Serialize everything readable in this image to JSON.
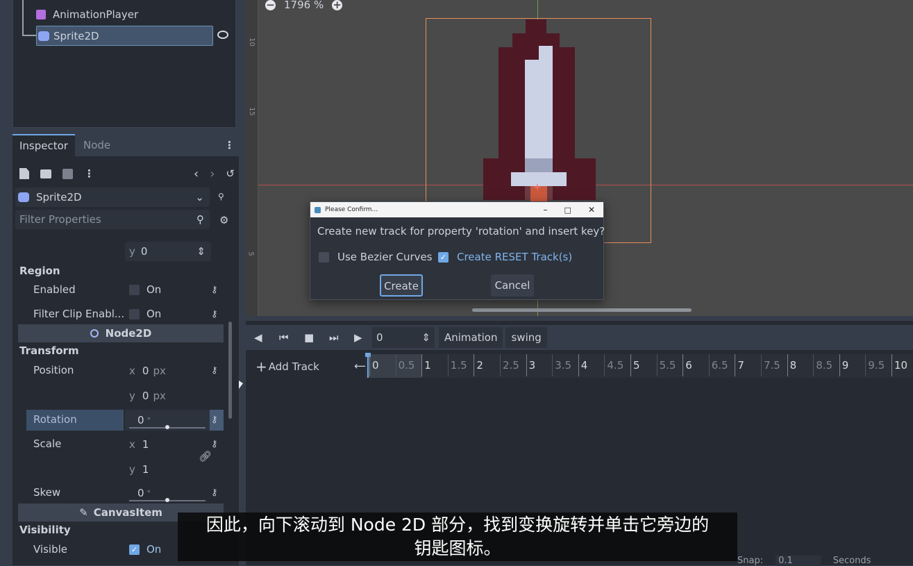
{
  "scene_tree": {
    "items": [
      {
        "label": "AnimationPlayer"
      },
      {
        "label": "Sprite2D"
      }
    ]
  },
  "inspector": {
    "tabs": [
      "Inspector",
      "Node"
    ],
    "object_name": "Sprite2D",
    "filter_placeholder": "Filter Properties",
    "offset_y": {
      "axis": "y",
      "value": "0"
    },
    "region": {
      "title": "Region",
      "enabled_label": "Enabled",
      "enabled_value": "On",
      "filter_clip_label": "Filter Clip Enabl...",
      "filter_clip_value": "On"
    },
    "node2d_header": "Node2D",
    "transform": {
      "title": "Transform",
      "position_label": "Position",
      "pos_x": "0",
      "pos_y": "0",
      "unit": "px",
      "rotation_label": "Rotation",
      "rotation_value": "0",
      "deg": "°",
      "scale_label": "Scale",
      "scale_x": "1",
      "scale_y": "1",
      "skew_label": "Skew",
      "skew_value": "0"
    },
    "canvasitem_header": "CanvasItem",
    "visibility": {
      "title": "Visibility",
      "visible_label": "Visible",
      "visible_value": "On"
    }
  },
  "viewport": {
    "zoom": "1796 %",
    "ruler_ticks": [
      "10",
      "15",
      "5"
    ]
  },
  "dialog": {
    "title": "Please Confirm...",
    "message": "Create new track for property 'rotation' and insert key?",
    "bezier_label": "Use Bezier Curves",
    "bezier_checked": false,
    "reset_label": "Create RESET Track(s)",
    "reset_checked": true,
    "create": "Create",
    "cancel": "Cancel"
  },
  "animation": {
    "time": "0",
    "animation_label": "Animation",
    "anim_name": "swing",
    "add_track": "Add Track",
    "ticks": [
      "0",
      "0.5",
      "1",
      "1.5",
      "2",
      "2.5",
      "3",
      "3.5",
      "4",
      "4.5",
      "5",
      "5.5",
      "6",
      "6.5",
      "7",
      "7.5",
      "8",
      "8.5",
      "9",
      "9.5",
      "10"
    ],
    "snap_label": "Snap:",
    "snap_value": "0.1",
    "seconds_label": "Seconds"
  },
  "subtitle": {
    "line1": "因此，向下滚动到 Node 2D 部分，找到变换旋转并单击它旁边的",
    "line2": "钥匙图标。"
  },
  "colors": {
    "accent": "#70a8e6",
    "panel": "#262b33",
    "viewport_bg": "#4a4a4a",
    "bbox": "#e8905c"
  }
}
